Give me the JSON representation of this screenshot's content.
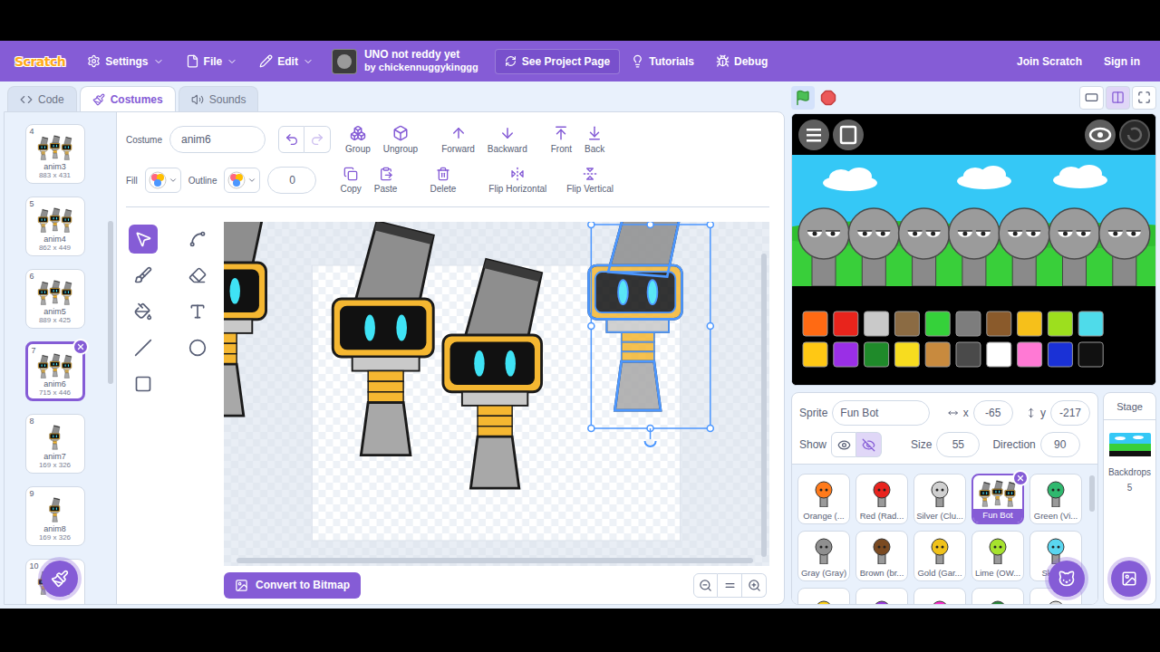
{
  "menu_bar": {
    "logo": "Scratch",
    "menus": [
      {
        "label": "Settings",
        "kind": "settings"
      },
      {
        "label": "File",
        "kind": "file"
      },
      {
        "label": "Edit",
        "kind": "edit"
      }
    ],
    "project_title": "UNO not reddy yet",
    "project_author": "by chickennuggykinggg",
    "see_project": "See Project Page",
    "links": [
      {
        "label": "Tutorials",
        "kind": "tutorials"
      },
      {
        "label": "Debug",
        "kind": "debug"
      }
    ],
    "join": "Join Scratch",
    "sign_in": "Sign in"
  },
  "tabs": [
    {
      "label": "Code",
      "kind": "code",
      "selected": false
    },
    {
      "label": "Costumes",
      "kind": "costumes",
      "selected": true
    },
    {
      "label": "Sounds",
      "kind": "sounds",
      "selected": false
    }
  ],
  "costumes": [
    {
      "number": "4",
      "name": "anim3",
      "size": "883 x 431",
      "selected": false
    },
    {
      "number": "5",
      "name": "anim4",
      "size": "862 x 449",
      "selected": false
    },
    {
      "number": "6",
      "name": "anim5",
      "size": "889 x 425",
      "selected": false
    },
    {
      "number": "7",
      "name": "anim6",
      "size": "715 x 446",
      "selected": true
    },
    {
      "number": "8",
      "name": "anim7",
      "size": "169 x 326",
      "selected": false
    },
    {
      "number": "9",
      "name": "anim8",
      "size": "169 x 326",
      "selected": false
    },
    {
      "number": "10",
      "name": "",
      "size": "",
      "selected": false
    }
  ],
  "paint_editor": {
    "costume_label": "Costume",
    "costume_name": "anim6",
    "undo_disabled": false,
    "redo_disabled": true,
    "arrange": [
      {
        "label": "Group",
        "kind": "group"
      },
      {
        "label": "Ungroup",
        "kind": "ungroup"
      },
      {
        "label": "Forward",
        "kind": "forward"
      },
      {
        "label": "Backward",
        "kind": "backward"
      },
      {
        "label": "Front",
        "kind": "front"
      },
      {
        "label": "Back",
        "kind": "back"
      }
    ],
    "fill_label": "Fill",
    "outline_label": "Outline",
    "outline_width": "0",
    "actions": [
      {
        "label": "Copy",
        "kind": "copy"
      },
      {
        "label": "Paste",
        "kind": "paste"
      },
      {
        "label": "Delete",
        "kind": "delete"
      },
      {
        "label": "Flip Horizontal",
        "kind": "flip-h"
      },
      {
        "label": "Flip Vertical",
        "kind": "flip-v"
      }
    ],
    "tools": [
      {
        "kind": "select",
        "selected": true
      },
      {
        "kind": "reshape",
        "selected": false
      },
      {
        "kind": "brush",
        "selected": false
      },
      {
        "kind": "eraser",
        "selected": false
      },
      {
        "kind": "fill",
        "selected": false
      },
      {
        "kind": "text",
        "selected": false
      },
      {
        "kind": "line",
        "selected": false
      },
      {
        "kind": "circle",
        "selected": false
      },
      {
        "kind": "rect",
        "selected": false
      }
    ],
    "convert": "Convert to Bitmap"
  },
  "stage_controls": {
    "flag_active": true,
    "layouts": [
      {
        "kind": "small",
        "selected": false
      },
      {
        "kind": "normal",
        "selected": true
      },
      {
        "kind": "fullscreen",
        "selected": false
      }
    ]
  },
  "stage": {
    "palette": [
      "#ff6a13",
      "#e8241c",
      "#c9c9c9",
      "#8b6b43",
      "#35d13a",
      "#7d7d7d",
      "#8a5a2b",
      "#f6c01a",
      "#9ddf1e",
      "#4fdbea",
      "#ffc814",
      "#9a2fe6",
      "#1f8a2a",
      "#f7dc1f",
      "#c88a3e",
      "#4a4a4a",
      "#ffffff",
      "#ff79d4",
      "#1a31d6",
      "#111111"
    ]
  },
  "sprite_info": {
    "sprite_label": "Sprite",
    "name": "Fun Bot",
    "x_label": "x",
    "x": "-65",
    "y_label": "y",
    "y": "-217",
    "show_label": "Show",
    "visible": false,
    "size_label": "Size",
    "size": "55",
    "direction_label": "Direction",
    "direction": "90"
  },
  "sprites": [
    {
      "name": "Orange (...",
      "kind": "character",
      "color": "#ff7a1a",
      "selected": false
    },
    {
      "name": "Red (Rad...",
      "kind": "character",
      "color": "#e8231e",
      "selected": false
    },
    {
      "name": "Silver (Clu...",
      "kind": "character",
      "color": "#d0d0d0",
      "selected": false
    },
    {
      "name": "Fun Bot",
      "kind": "robot",
      "color": "#f5b731",
      "selected": true
    },
    {
      "name": "Green (Vi...",
      "kind": "character",
      "color": "#2fb86e",
      "selected": false
    },
    {
      "name": "Gray (Gray)",
      "kind": "character",
      "color": "#8f8f8f",
      "selected": false
    },
    {
      "name": "Brown (br...",
      "kind": "character",
      "color": "#7a4a22",
      "selected": false
    },
    {
      "name": "Gold (Gar...",
      "kind": "character",
      "color": "#f0c21a",
      "selected": false
    },
    {
      "name": "Lime (OW...",
      "kind": "character",
      "color": "#a6e22e",
      "selected": false
    },
    {
      "name": "Sky blu",
      "kind": "character",
      "color": "#5ad6f0",
      "selected": false
    },
    {
      "name": "",
      "kind": "character",
      "color": "#ffd21a",
      "selected": false
    },
    {
      "name": "",
      "kind": "character",
      "color": "#9b3de0",
      "selected": false
    },
    {
      "name": "",
      "kind": "character",
      "color": "#ff2fd0",
      "selected": false
    },
    {
      "name": "",
      "kind": "character",
      "color": "#2c8a3c",
      "selected": false
    },
    {
      "name": "",
      "kind": "character",
      "color": "#e0e0e0",
      "selected": false
    }
  ],
  "stage_panel": {
    "label": "Stage",
    "backdrops_label": "Backdrops",
    "backdrops_count": "5"
  }
}
